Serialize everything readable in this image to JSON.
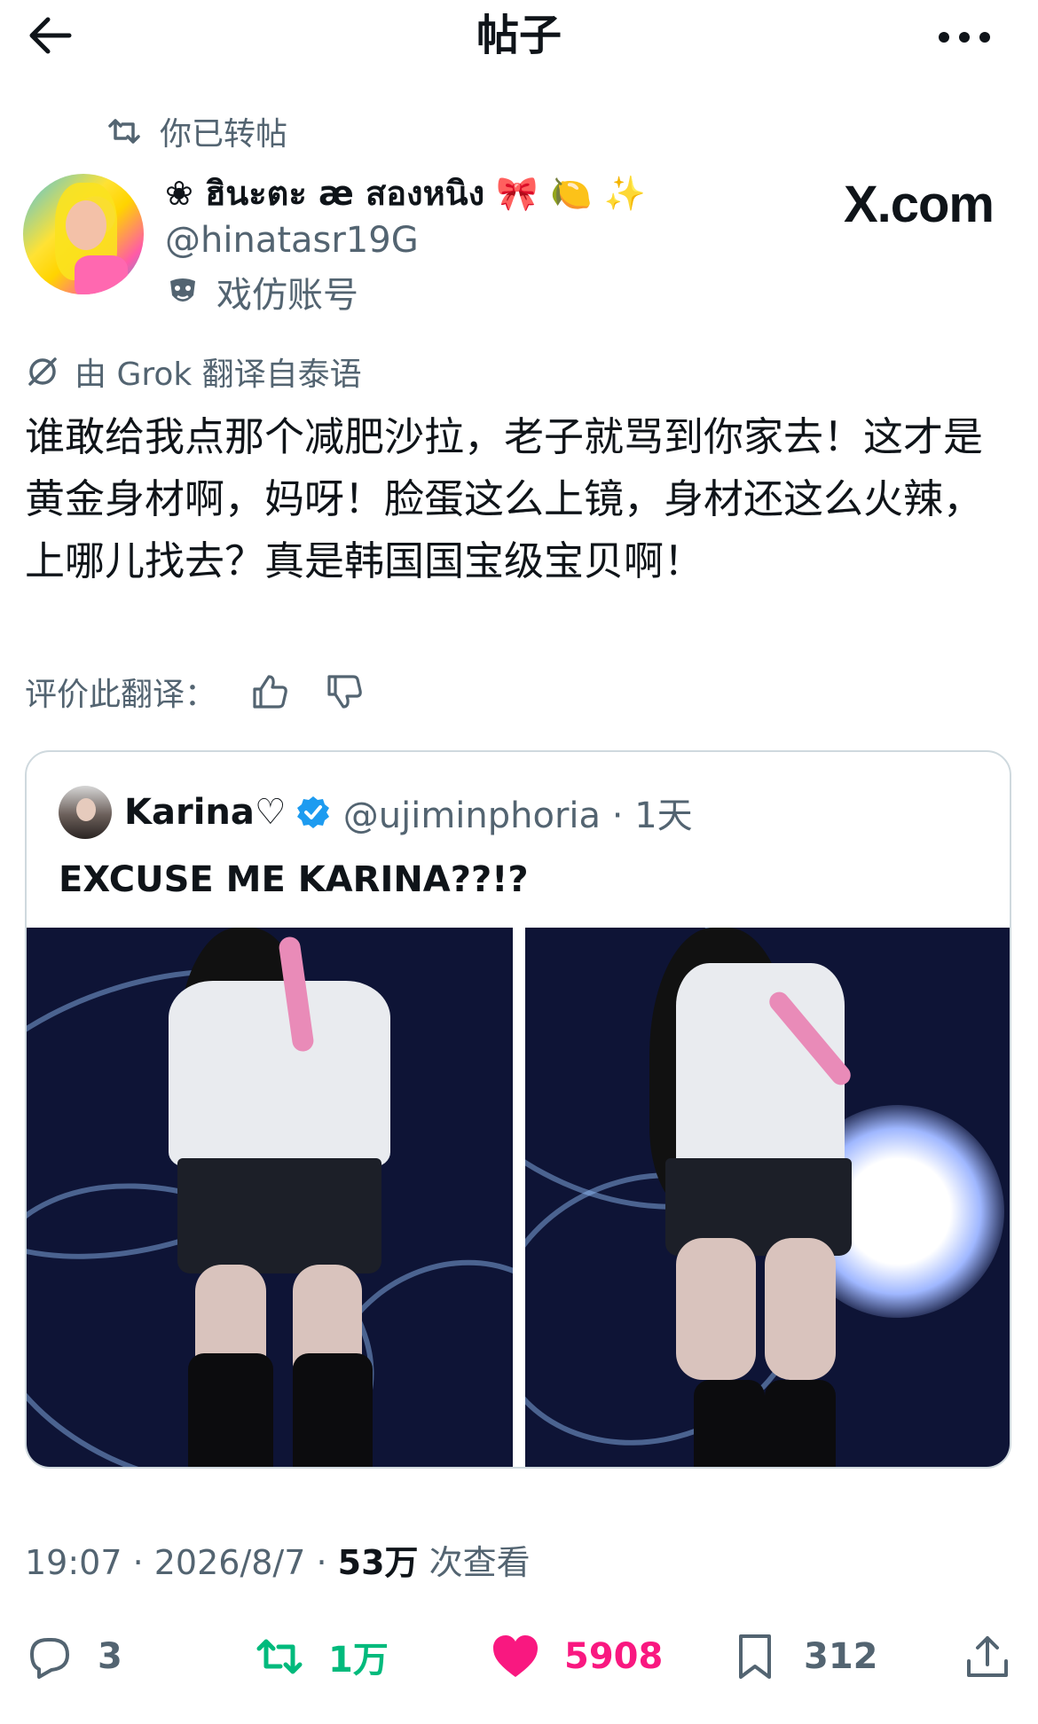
{
  "header": {
    "title": "帖子"
  },
  "repost_label": "你已转帖",
  "author": {
    "display_name": "❀ ฮินะตะ æ สองหนิง 🎀 🍋 ✨",
    "handle": "@hinatasr19G",
    "parody_label": "戏仿账号"
  },
  "watermark": "X.com",
  "translation": {
    "label": "由 Grok 翻译自泰语",
    "rate_label": "评价此翻译："
  },
  "tweet_text": "谁敢给我点那个减肥沙拉，老子就骂到你家去！这才是黄金身材啊，妈呀！脸蛋这么上镜，身材还这么火辣，上哪儿找去？真是韩国国宝级宝贝啊！",
  "quote": {
    "name": "Karina♡",
    "handle_time": "@ujiminphoria · 1天",
    "text": "EXCUSE ME KARINA??!?"
  },
  "meta": {
    "time_date": "19:07 · 2026/8/7 · ",
    "views_count": "53万",
    "views_label": " 次查看"
  },
  "actions": {
    "replies": "3",
    "reposts": "1万",
    "likes": "5908",
    "bookmarks": "312"
  },
  "colors": {
    "repost_green": "#00ba7c",
    "like_pink": "#f91880",
    "verified_blue": "#1d9bf0",
    "secondary_text": "#536471"
  }
}
